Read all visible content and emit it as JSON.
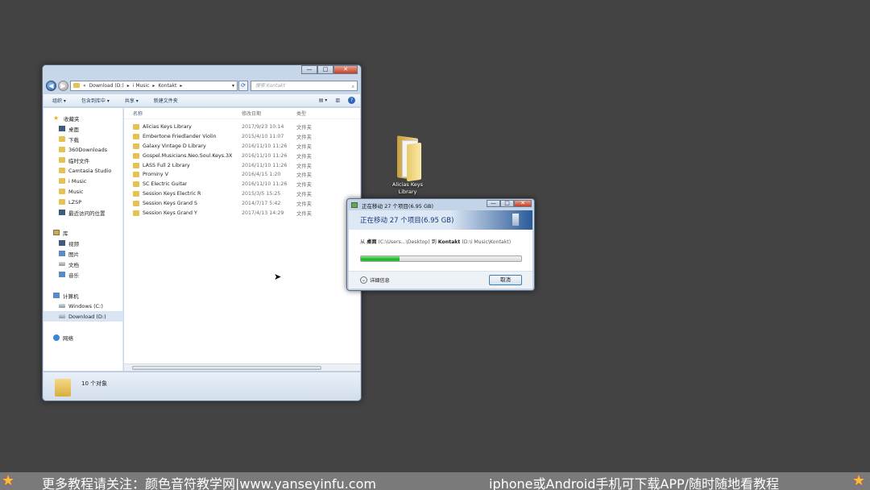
{
  "explorer": {
    "titlebar": {
      "minimize": "—",
      "maximize": "□",
      "close": "✕"
    },
    "address": {
      "crumbs": [
        "«",
        "Download (D:)",
        "▸",
        "i Music",
        "▸",
        "Kontakt",
        "▸"
      ],
      "dropdown": "▾",
      "refresh": "⟳"
    },
    "search_placeholder": "搜索 Kontakt",
    "toolbar": {
      "organize": "组织 ▾",
      "include_library": "包含到库中 ▾",
      "share": "共享 ▾",
      "new_folder": "新建文件夹",
      "view": "▤ ▾",
      "preview": "▥",
      "help": "?"
    },
    "nav": {
      "favorites": {
        "title": "收藏夹",
        "items": [
          "桌面",
          "下载",
          "360Downloads",
          "临时文件",
          "Camtasia Studio",
          "i Music",
          "Music",
          "LZSP",
          "最近访问的位置"
        ]
      },
      "libraries": {
        "title": "库",
        "items": [
          "视频",
          "图片",
          "文档",
          "音乐"
        ]
      },
      "computer": {
        "title": "计算机",
        "items": [
          "Windows (C:)",
          "Download (D:)"
        ]
      },
      "network": {
        "title": "网络"
      }
    },
    "columns": {
      "name": "名称",
      "date": "修改日期",
      "type": "类型",
      "sort_arrow": "▲"
    },
    "files": [
      {
        "name": "Alicias Keys Library",
        "date": "2017/9/23 10:14",
        "type": "文件夹"
      },
      {
        "name": "Embertone Friedlander Violin",
        "date": "2015/4/10 11:07",
        "type": "文件夹"
      },
      {
        "name": "Galaxy Vintage D Library",
        "date": "2016/11/10 11:26",
        "type": "文件夹"
      },
      {
        "name": "Gospel.Musicians.Neo.Soul.Keys.3X",
        "date": "2016/11/10 11:26",
        "type": "文件夹"
      },
      {
        "name": "LASS Full 2 Library",
        "date": "2016/11/10 11:26",
        "type": "文件夹"
      },
      {
        "name": "Prominy V",
        "date": "2016/4/15 1:20",
        "type": "文件夹"
      },
      {
        "name": "SC Electric Guitar",
        "date": "2016/11/10 11:26",
        "type": "文件夹"
      },
      {
        "name": "Session Keys Electric R",
        "date": "2015/3/5 15:25",
        "type": "文件夹"
      },
      {
        "name": "Session Keys Grand S",
        "date": "2014/7/17 5:42",
        "type": "文件夹"
      },
      {
        "name": "Session Keys Grand Y",
        "date": "2017/4/13 14:29",
        "type": "文件夹"
      }
    ],
    "status": "10 个对象"
  },
  "desktop_icon": {
    "line1": "Alicias Keys",
    "line2": "Library"
  },
  "dialog": {
    "title": "正在移动 27 个项目(6.95 GB)",
    "headline": "正在移动 27 个项目(6.95 GB)",
    "from_label": "从",
    "from_name": "桌面",
    "from_path": "(C:\\Users...\\Desktop)",
    "to_label": "到",
    "to_name": "Kontakt",
    "to_path": "(D:\\i Music\\Kontakt)",
    "progress_percent": 24,
    "details_label": "详细信息",
    "details_chevron": "⌄",
    "cancel_label": "取消",
    "controls": {
      "minimize": "—",
      "maximize": "□",
      "close": "✕"
    }
  },
  "banner": {
    "left_text": "更多教程请关注：颜色音符教学网|www.yanseyinfu.com",
    "right_text": "iphone或Android手机可下载APP/随时随地看教程",
    "star": "★"
  },
  "colors": {
    "desktop": "#434343",
    "window_frame": "#c7d6e8",
    "progress_fill": "#1fb324",
    "banner": "#7a7a7a"
  }
}
